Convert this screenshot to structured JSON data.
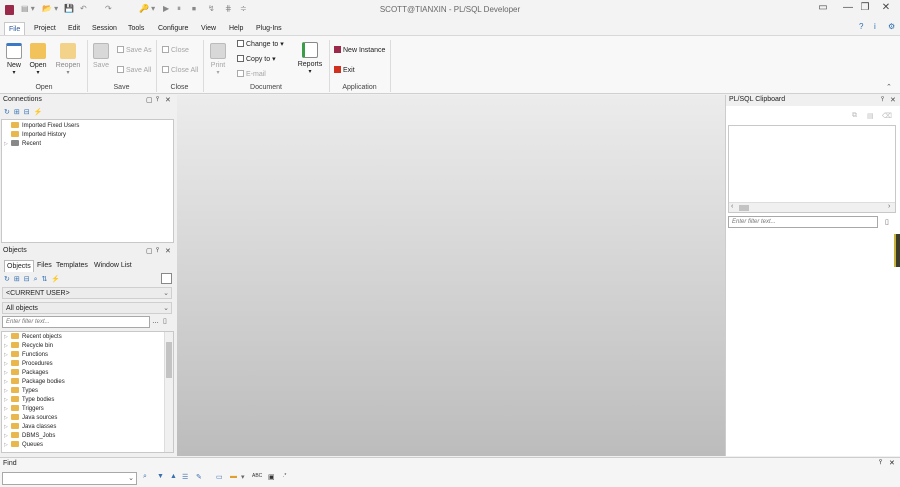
{
  "window": {
    "title": "SCOTT@TIANXIN - PL/SQL Developer",
    "controls": {
      "restore": "▭",
      "minimize": "—",
      "maximize": "❐",
      "close": "✕"
    }
  },
  "quick_access": [
    "▤ ▾",
    "📂 ▾",
    "💾",
    "↶",
    "↷",
    "🔑 ▾",
    "▶",
    "⏸",
    "⏹",
    "↯",
    "⋕",
    "≑"
  ],
  "menu": [
    "File",
    "Project",
    "Edit",
    "Session",
    "Tools",
    "Configure",
    "View",
    "Help",
    "Plug-Ins"
  ],
  "help_icons": [
    "?",
    "i",
    "⚙"
  ],
  "ribbon": {
    "open_group": {
      "label": "Open",
      "new": "New",
      "open": "Open",
      "reopen": "Reopen"
    },
    "save_group": {
      "label": "Save",
      "save": "Save",
      "save_as": "Save As",
      "save_all": "Save All"
    },
    "close_group": {
      "label": "Close",
      "close": "Close",
      "close_all": "Close All"
    },
    "document_group": {
      "label": "Document",
      "print": "Print",
      "change_to": "Change to",
      "copy_to": "Copy to",
      "email": "E-mail",
      "reports": "Reports"
    },
    "application_group": {
      "label": "Application",
      "new_instance": "New Instance",
      "exit": "Exit"
    }
  },
  "connections": {
    "title": "Connections",
    "items": [
      "Imported Fixed Users",
      "Imported History",
      "Recent"
    ]
  },
  "objects": {
    "title": "Objects",
    "tabs": [
      "Objects",
      "Files",
      "Templates",
      "Window List"
    ],
    "user_select": "<CURRENT USER>",
    "scope_select": "All objects",
    "filter_placeholder": "Enter filter text...",
    "items": [
      "Recent objects",
      "Recycle bin",
      "Functions",
      "Procedures",
      "Packages",
      "Package bodies",
      "Types",
      "Type bodies",
      "Triggers",
      "Java sources",
      "Java classes",
      "DBMS_Jobs",
      "Queues"
    ]
  },
  "clipboard": {
    "title": "PL/SQL Clipboard",
    "filter_placeholder": "Enter filter text..."
  },
  "find": {
    "title": "Find",
    "value": ""
  },
  "colors": {
    "accent": "#2b579a",
    "folder": "#e8b84f",
    "exit": "#d03020"
  }
}
